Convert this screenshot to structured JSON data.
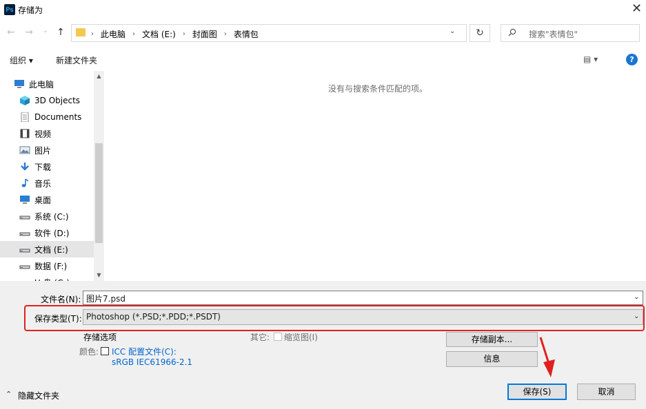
{
  "window": {
    "app_icon_text": "Ps",
    "title": "存储为",
    "close_glyph": "✕"
  },
  "nav": {
    "back_glyph": "←",
    "forward_glyph": "→",
    "history_glyph": "⌄",
    "up_glyph": "↑",
    "breadcrumbs": [
      "此电脑",
      "文档 (E:)",
      "封面图",
      "表情包"
    ],
    "crumb_sep": "›",
    "refresh_glyph": "↻",
    "search_placeholder": "搜索\"表情包\""
  },
  "toolbar": {
    "organize": "组织 ▾",
    "new_folder": "新建文件夹",
    "view_glyph": "▤ ▾",
    "help_glyph": "?"
  },
  "tree": {
    "items": [
      {
        "label": "此电脑",
        "icon": "computer-icon",
        "color": "#2b7cd3"
      },
      {
        "label": "3D Objects",
        "icon": "3d-objects-icon",
        "color": "#2ba3d6"
      },
      {
        "label": "Documents",
        "icon": "documents-icon",
        "color": "#8a8a8a"
      },
      {
        "label": "视频",
        "icon": "video-icon",
        "color": "#444444"
      },
      {
        "label": "图片",
        "icon": "pictures-icon",
        "color": "#6a7f99"
      },
      {
        "label": "下载",
        "icon": "download-icon",
        "color": "#2b7cd3"
      },
      {
        "label": "音乐",
        "icon": "music-icon",
        "color": "#2b7cd3"
      },
      {
        "label": "桌面",
        "icon": "desktop-icon",
        "color": "#2b7cd3"
      },
      {
        "label": "系统 (C:)",
        "icon": "drive-c-icon",
        "color": "#555555"
      },
      {
        "label": "软件 (D:)",
        "icon": "drive-icon",
        "color": "#555555"
      },
      {
        "label": "文档 (E:)",
        "icon": "drive-icon",
        "color": "#555555",
        "selected": true
      },
      {
        "label": "数据 (F:)",
        "icon": "drive-icon",
        "color": "#555555"
      },
      {
        "label": "U 盘 (G:)",
        "icon": "drive-icon",
        "color": "#555555"
      }
    ]
  },
  "main": {
    "empty_message": "没有与搜索条件匹配的项。"
  },
  "form": {
    "filename_label": "文件名(N):",
    "filename_value": "图片7.psd",
    "filetype_label": "保存类型(T):",
    "filetype_value": "Photoshop (*.PSD;*.PDD;*.PSDT)",
    "dropdown_glyph": "⌄"
  },
  "options": {
    "save_options": "存储选项",
    "other_label": "其它:",
    "thumbnail_label": "缩览图(I)",
    "color_label": "颜色:",
    "icc_label": "ICC 配置文件(C):",
    "icc_profile": "sRGB IEC61966-2.1",
    "save_copy_button": "存储副本...",
    "info_button": "信息"
  },
  "footer": {
    "hide_folders": "隐藏文件夹",
    "hide_glyph": "⌃",
    "save_button": "保存(S)",
    "cancel_button": "取消"
  },
  "accent_colors": {
    "highlight_frame": "#e02020",
    "arrow": "#e02020",
    "link": "#0066cc"
  }
}
